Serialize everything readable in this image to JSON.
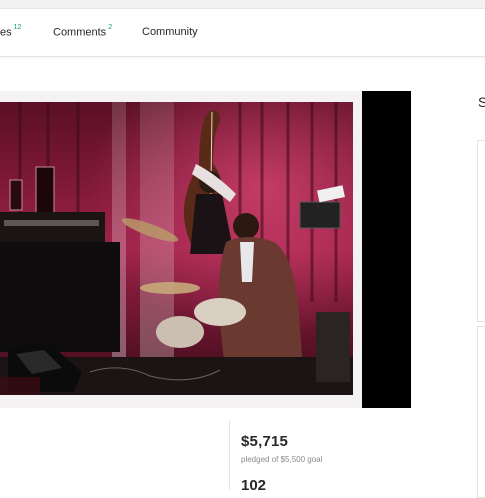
{
  "tabs": [
    {
      "label": "es",
      "count": "12"
    },
    {
      "label": "Comments",
      "count": "2"
    },
    {
      "label": "Community",
      "count": ""
    }
  ],
  "sidebar": {
    "heading_fragment": "S"
  },
  "stats": {
    "pledged_amount": "$5,715",
    "goal_text": "pledged of $5,500 goal",
    "backers_fragment": "102"
  },
  "video": {
    "description": "Live jazz photo: bassist and drummer on stage with red curtain"
  },
  "colors": {
    "accent": "#009e74",
    "curtain": "#8c1e3c",
    "text": "#282828"
  }
}
